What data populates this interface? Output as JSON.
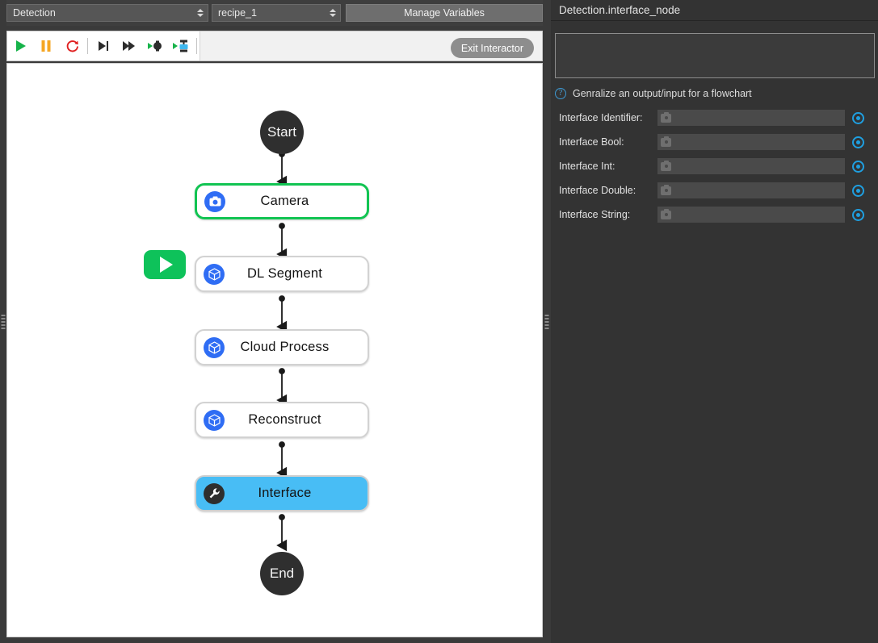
{
  "toolbar_top": {
    "project_combo": {
      "value": "Detection",
      "icon": "updown-arrows-icon"
    },
    "recipe_combo": {
      "value": "recipe_1",
      "icon": "updown-arrows-icon"
    },
    "manage_variables_label": "Manage Variables"
  },
  "run_toolbar": {
    "buttons": [
      {
        "name": "run-button",
        "icon": "play-icon",
        "color": "#16b34a"
      },
      {
        "name": "pause-button",
        "icon": "pause-icon",
        "color": "#f5a623"
      },
      {
        "name": "reset-button",
        "icon": "refresh-icon",
        "color": "#e02020"
      },
      {
        "name": "step-into-button",
        "icon": "step-next-icon",
        "color": "#2c2c2c"
      },
      {
        "name": "step-over-button",
        "icon": "fast-forward-icon",
        "color": "#2c2c2c"
      },
      {
        "name": "run-to-node-button",
        "icon": "play-node-icon",
        "color": "#2c2c2c"
      },
      {
        "name": "run-interactor-button",
        "icon": "play-interactor-icon",
        "color": "#2c2c2c"
      }
    ],
    "exit_interactor_label": "Exit Interactor"
  },
  "flowchart": {
    "start_label": "Start",
    "end_label": "End",
    "run_badge_icon": "play-icon",
    "nodes": [
      {
        "label": "Camera",
        "icon": "camera-icon",
        "icon_style": "blue",
        "state": "highlighted-green"
      },
      {
        "label": "DL Segment",
        "icon": "cube-icon",
        "icon_style": "blue",
        "state": "normal"
      },
      {
        "label": "Cloud Process",
        "icon": "cube-icon",
        "icon_style": "blue",
        "state": "normal"
      },
      {
        "label": "Reconstruct",
        "icon": "cube-icon",
        "icon_style": "blue",
        "state": "normal"
      },
      {
        "label": "Interface",
        "icon": "wrench-icon",
        "icon_style": "dark",
        "state": "selected-blue"
      }
    ]
  },
  "properties_panel": {
    "title": "Detection.interface_node",
    "notes_value": "",
    "description_icon": "help-circle-icon",
    "description": "Genralize an output/input for a flowchart",
    "fields": [
      {
        "label": "Interface Identifier:",
        "value": "",
        "field_icon": "camera-icon",
        "action_icon": "record-target-icon"
      },
      {
        "label": "Interface Bool:",
        "value": "",
        "field_icon": "camera-icon",
        "action_icon": "record-target-icon"
      },
      {
        "label": "Interface Int:",
        "value": "",
        "field_icon": "camera-icon",
        "action_icon": "record-target-icon"
      },
      {
        "label": "Interface Double:",
        "value": "",
        "field_icon": "camera-icon",
        "action_icon": "record-target-icon"
      },
      {
        "label": "Interface String:",
        "value": "",
        "field_icon": "camera-icon",
        "action_icon": "record-target-icon"
      }
    ]
  },
  "colors": {
    "selected_node": "#48bdf5",
    "highlight_border": "#11c452",
    "node_icon_blue": "#2f6df4",
    "accent_blue": "#1f9fe0",
    "run_green": "#0ec25a"
  }
}
